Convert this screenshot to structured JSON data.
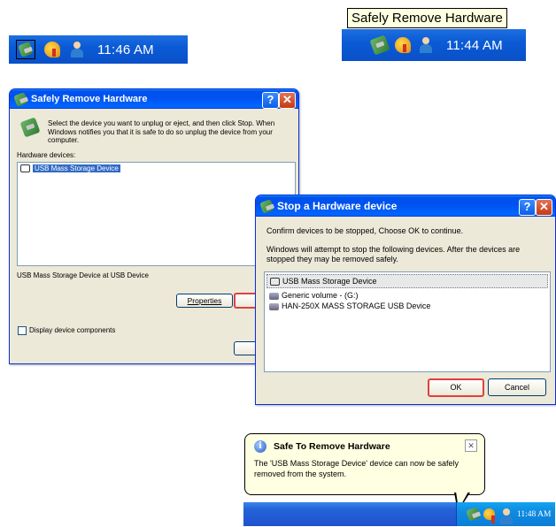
{
  "tray1": {
    "clock": "11:46 AM"
  },
  "tray2": {
    "clock": "11:44 AM",
    "tooltip": "Safely Remove Hardware"
  },
  "srh": {
    "title": "Safely Remove Hardware",
    "instructions": "Select the device you want to unplug or eject, and then click Stop. When Windows notifies you that it is safe to do so unplug the device from your computer.",
    "hardware_label": "Hardware devices:",
    "devices": [
      "USB Mass Storage Device"
    ],
    "status_text": "USB Mass Storage Device at USB Device",
    "properties_label": "Properties",
    "stop_label": "S",
    "display_components_label": "Display device components",
    "close_label": "C"
  },
  "stop": {
    "title": "Stop a Hardware device",
    "confirm_text": "Confirm devices to be stopped, Choose OK to continue.",
    "info_text": "Windows will attempt to stop the following devices. After the devices are stopped they may be removed safely.",
    "devices": [
      "USB Mass Storage Device",
      "Generic volume - (G:)",
      "HAN-250X MASS STORAGE USB Device"
    ],
    "ok_label": "OK",
    "cancel_label": "Cancel"
  },
  "balloon": {
    "title": "Safe To Remove Hardware",
    "message": "The 'USB Mass Storage Device' device can now be safely removed from the system.",
    "clock": "11:48 AM"
  },
  "icons": [
    "usb-hardware-icon",
    "keys-icon",
    "user-icon",
    "help-icon",
    "close-icon",
    "info-icon"
  ],
  "colors": {
    "highlight": "#316ac5",
    "accent_red": "#e04040",
    "title_blue": "#0053ee"
  }
}
